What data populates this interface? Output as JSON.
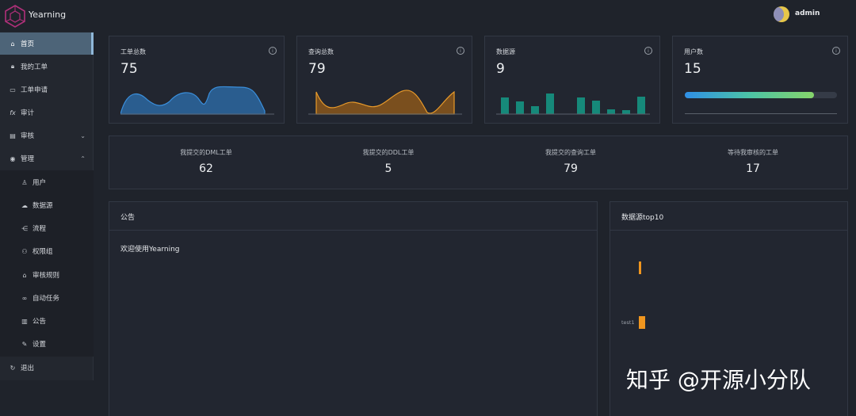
{
  "app": {
    "name": "Yearning"
  },
  "user": {
    "name": "admin"
  },
  "sidebar": {
    "items": [
      {
        "label": "首页",
        "icon": "home-icon"
      },
      {
        "label": "我的工单",
        "icon": "lock-icon"
      },
      {
        "label": "工单申请",
        "icon": "monitor-icon"
      },
      {
        "label": "审计",
        "icon": "function-icon"
      },
      {
        "label": "审核",
        "icon": "review-icon"
      },
      {
        "label": "管理",
        "icon": "eye-icon"
      },
      {
        "label": "用户",
        "icon": "user-icon"
      },
      {
        "label": "数据源",
        "icon": "cloud-icon"
      },
      {
        "label": "流程",
        "icon": "flow-icon"
      },
      {
        "label": "权限组",
        "icon": "group-icon"
      },
      {
        "label": "审核规则",
        "icon": "house-icon"
      },
      {
        "label": "自动任务",
        "icon": "link-icon"
      },
      {
        "label": "公告",
        "icon": "chart-icon"
      },
      {
        "label": "设置",
        "icon": "wrench-icon"
      },
      {
        "label": "退出",
        "icon": "logout-icon"
      }
    ]
  },
  "stats": [
    {
      "label": "工单总数",
      "value": "75"
    },
    {
      "label": "查询总数",
      "value": "79"
    },
    {
      "label": "数据源",
      "value": "9"
    },
    {
      "label": "用户数",
      "value": "15"
    }
  ],
  "user_progress": 0.85,
  "colors": {
    "blue": "#2f7fc8",
    "orange": "#e89a2a",
    "teal": "#16897a",
    "bar": "#f0961f",
    "active": "#4d6478"
  },
  "summary": [
    {
      "label": "我提交的DML工单",
      "value": "62"
    },
    {
      "label": "我提交的DDL工单",
      "value": "5"
    },
    {
      "label": "我提交的查询工单",
      "value": "79"
    },
    {
      "label": "等待我审核的工单",
      "value": "17"
    }
  ],
  "notice": {
    "title": "公告",
    "content": "欢迎使用Yearning"
  },
  "top10": {
    "title": "数据源top10"
  },
  "chart_data": {
    "type": "bar",
    "orientation": "horizontal",
    "categories": [
      "",
      "test1"
    ],
    "values": [
      3,
      9
    ]
  },
  "watermark": "知乎 @开源小分队"
}
